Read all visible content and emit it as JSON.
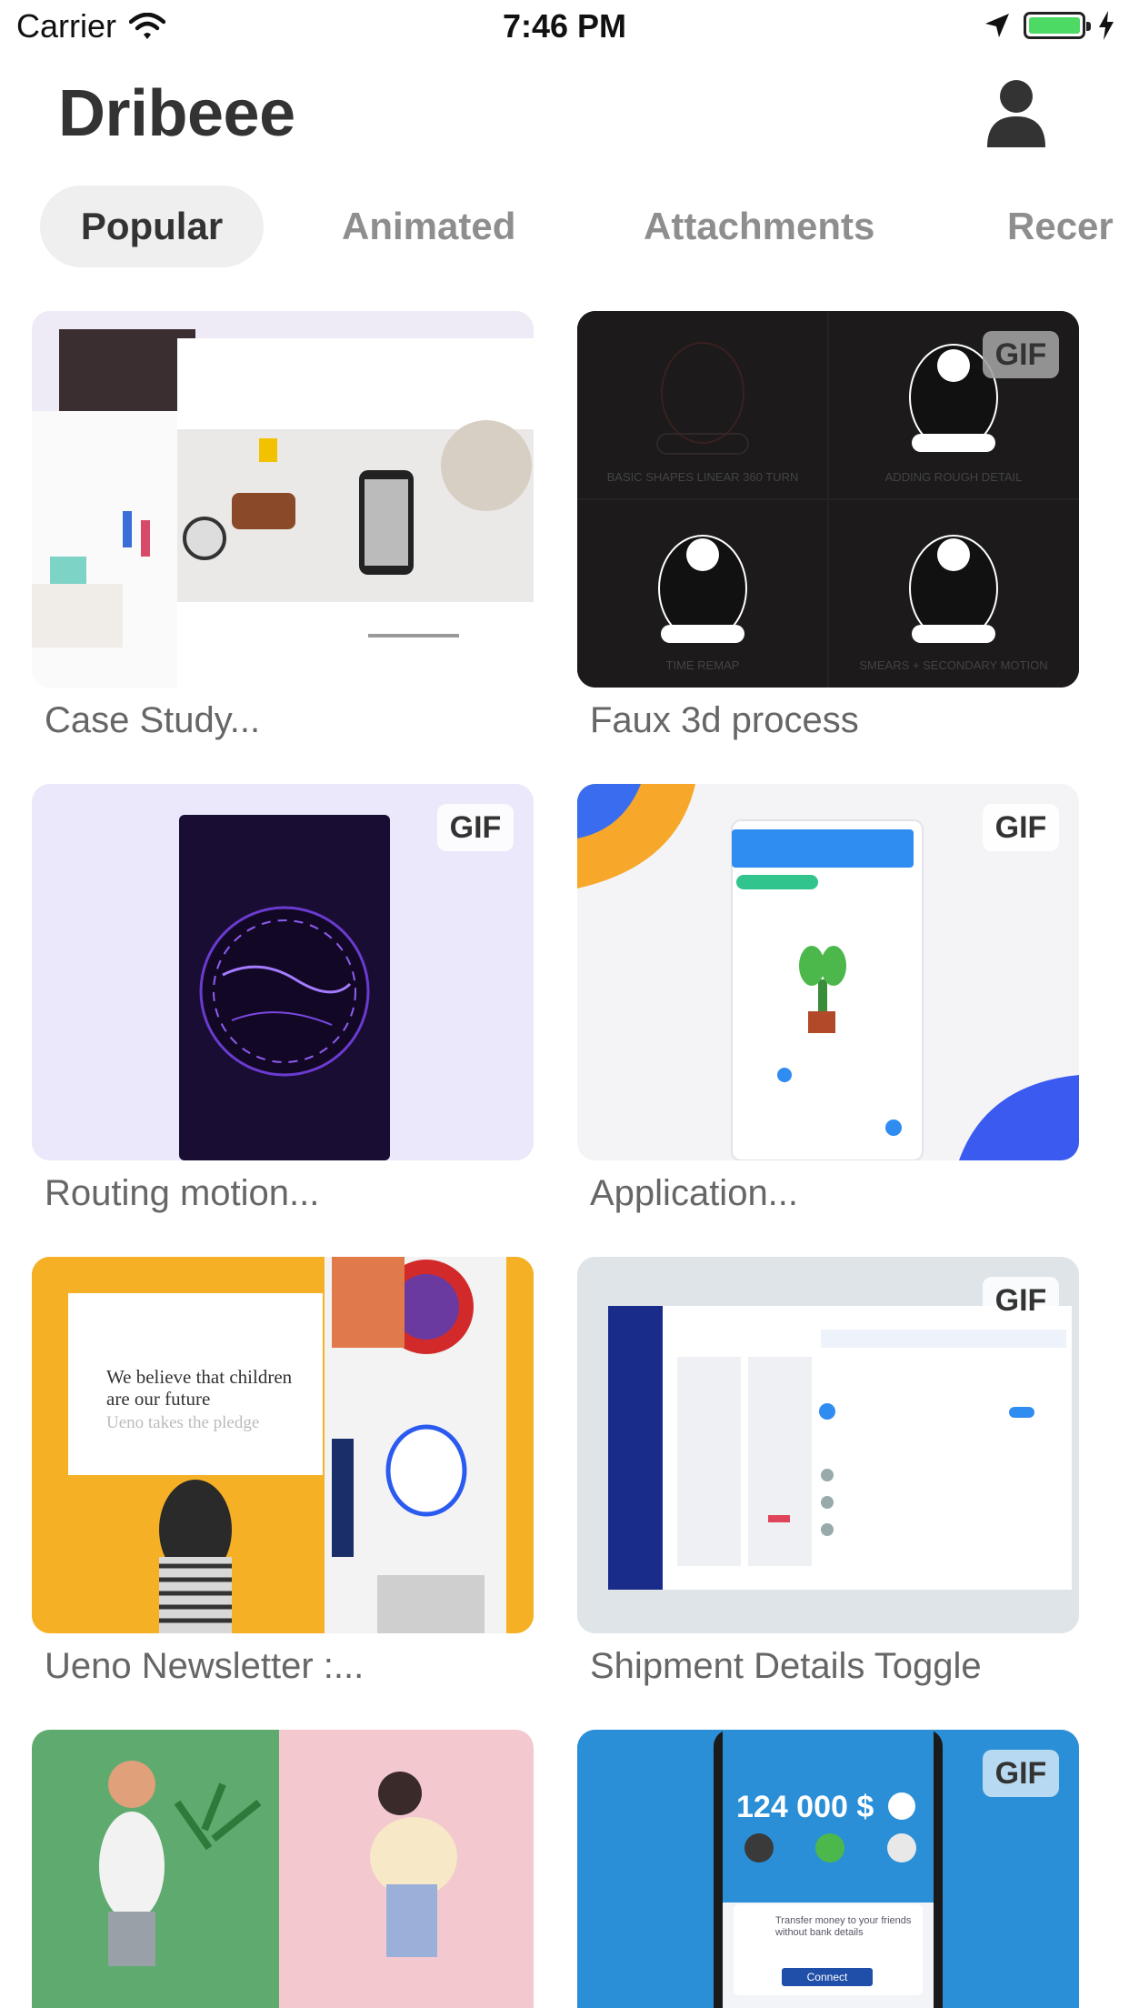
{
  "status_bar": {
    "carrier": "Carrier",
    "time": "7:46 PM",
    "battery_level": 1.0,
    "icons": [
      "wifi-icon",
      "location-arrow-icon",
      "battery-icon",
      "charging-bolt-icon"
    ]
  },
  "nav": {
    "title": "Dribeee",
    "profile_icon": "person-icon"
  },
  "tabs": [
    {
      "label": "Popular",
      "active": true
    },
    {
      "label": "Animated",
      "active": false
    },
    {
      "label": "Attachments",
      "active": false
    },
    {
      "label": "Recer",
      "active": false
    }
  ],
  "shots": [
    {
      "title": "Case Study...",
      "gif": false
    },
    {
      "title": "Faux 3d process",
      "gif": true,
      "gif_label": "GIF"
    },
    {
      "title": "Routing motion...",
      "gif": true,
      "gif_label": "GIF"
    },
    {
      "title": "Application...",
      "gif": true,
      "gif_label": "GIF"
    },
    {
      "title": "Ueno Newsletter :...",
      "gif": false
    },
    {
      "title": "Shipment Details Toggle",
      "gif": true,
      "gif_label": "GIF"
    },
    {
      "title": "",
      "gif": false
    },
    {
      "title": "",
      "gif": true,
      "gif_label": "GIF"
    }
  ],
  "thumb_text": {
    "faux_labels": [
      "BASIC SHAPES LINEAR 360 TURN",
      "ADDING ROUGH DETAIL",
      "TIME REMAP",
      "SMEARS + SECONDARY MOTION"
    ],
    "ueno_headline": "We believe that children are our future",
    "ueno_sub": "Ueno takes the pledge",
    "bank_amount": "124 000 $",
    "bank_notice": "Transfer money to your friends without bank details",
    "bank_button": "Connect"
  },
  "colors": {
    "accent_green": "#4cd964",
    "title": "#333333",
    "tab_inactive": "#8e8e8e",
    "tab_active_bg": "#efefef"
  }
}
